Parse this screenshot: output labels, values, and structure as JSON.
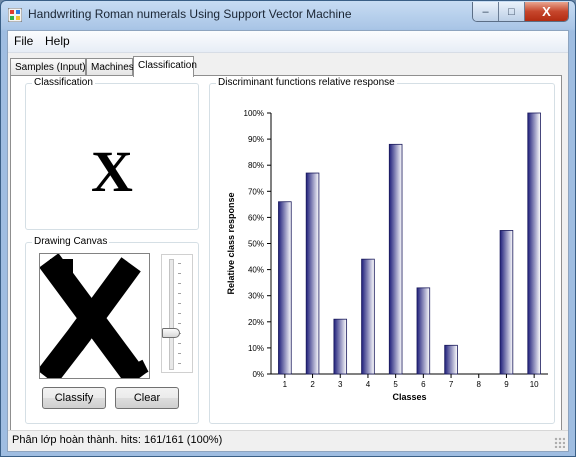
{
  "window": {
    "title": "Handwriting Roman numerals Using Support Vector Machine",
    "controls": {
      "minimize": "–",
      "maximize": "□",
      "close": "X"
    }
  },
  "menu": [
    "File",
    "Help"
  ],
  "tabs": [
    {
      "label": "Samples (Input)",
      "active": false
    },
    {
      "label": "Machines",
      "active": false
    },
    {
      "label": "Classification",
      "active": true
    }
  ],
  "classification": {
    "legend": "Classification",
    "result": "X"
  },
  "drawing": {
    "legend": "Drawing Canvas",
    "slider_level": 0.75,
    "classify_label": "Classify",
    "clear_label": "Clear"
  },
  "chart_panel": {
    "legend": "Discriminant functions relative response"
  },
  "chart_data": {
    "type": "bar",
    "categories": [
      "1",
      "2",
      "3",
      "4",
      "5",
      "6",
      "7",
      "8",
      "9",
      "10"
    ],
    "values": [
      66,
      77,
      21,
      44,
      88,
      33,
      11,
      0,
      55,
      100
    ],
    "ylabel": "Relative class response",
    "xlabel": "Classes",
    "ylim": [
      0,
      100
    ],
    "yticks": [
      "0%",
      "10%",
      "20%",
      "30%",
      "40%",
      "50%",
      "60%",
      "70%",
      "80%",
      "90%",
      "100%"
    ],
    "colors": {
      "bar_dark": "#1e1e7a",
      "bar_light": "#ffffff"
    }
  },
  "status": {
    "text": "Phân lớp hoàn thành. hits: 161/161 (100%)"
  }
}
